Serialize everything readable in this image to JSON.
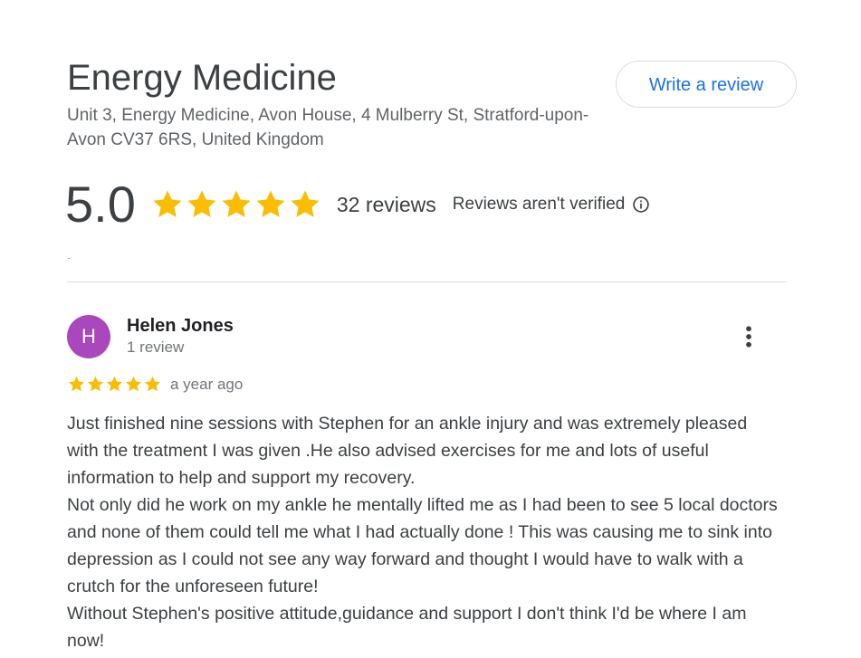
{
  "business": {
    "name": "Energy Medicine",
    "address": "Unit 3, Energy Medicine, Avon House, 4 Mulberry St, Stratford-upon-Avon CV37 6RS, United Kingdom",
    "write_review_label": "Write a review"
  },
  "summary": {
    "rating": "5.0",
    "stars": 5,
    "review_count": "32 reviews",
    "verification_note": "Reviews aren't verified",
    "star_color": "#fbbc04"
  },
  "reviews": [
    {
      "avatar_letter": "H",
      "avatar_color": "#ab47bc",
      "name": "Helen Jones",
      "meta": "1 review",
      "stars": 5,
      "time": "a year ago",
      "paragraphs": [
        "Just finished nine sessions with Stephen for an ankle injury and was extremely pleased with the treatment I was given .He also advised exercises for me and lots of useful information to help and support my recovery.",
        "Not only did he work on my ankle he mentally lifted me as I had been to see 5 local doctors and none of them could tell me what I had actually done ! This was causing me to sink into depression as I could not see any way forward and thought I would have to walk with a crutch for the unforeseen future!",
        "Without Stephen's positive attitude,guidance and support I don't think I'd be where I am now!"
      ]
    }
  ],
  "icons": {
    "star": "star-icon",
    "info": "info-icon",
    "more": "more-vert-icon"
  }
}
